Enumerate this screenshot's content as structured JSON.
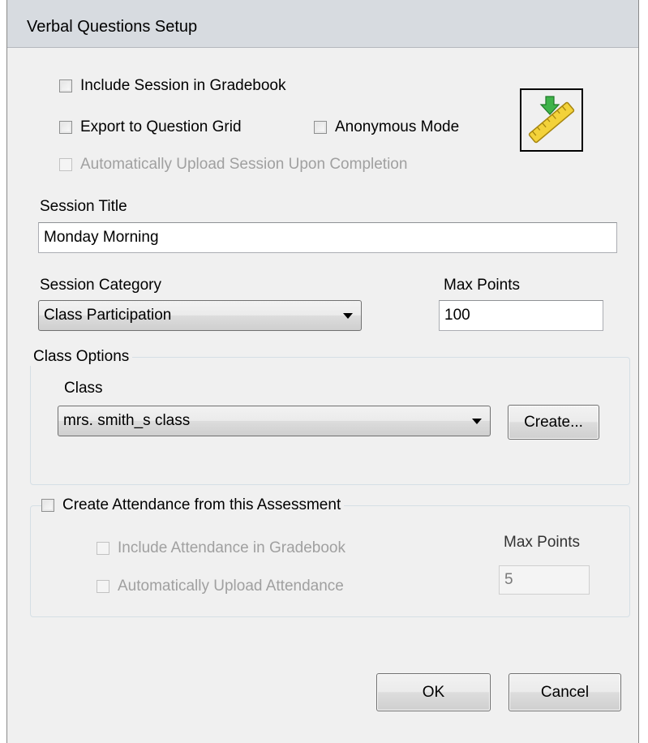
{
  "window": {
    "title": "Verbal Questions Setup"
  },
  "options": {
    "include_gradebook": {
      "label": "Include Session in Gradebook",
      "checked": false,
      "enabled": true
    },
    "export_grid": {
      "label": "Export to Question Grid",
      "checked": false,
      "enabled": true
    },
    "anonymous_mode": {
      "label": "Anonymous Mode",
      "checked": false,
      "enabled": true
    },
    "auto_upload": {
      "label": "Automatically Upload Session Upon Completion",
      "checked": false,
      "enabled": false
    }
  },
  "icon": {
    "name": "ruler-download-icon"
  },
  "session_title": {
    "label": "Session Title",
    "value": "Monday Morning"
  },
  "session_category": {
    "label": "Session Category",
    "selected": "Class Participation"
  },
  "max_points": {
    "label": "Max Points",
    "value": "100"
  },
  "class_options": {
    "group_title": "Class Options",
    "class_label": "Class",
    "class_selected": "mrs. smith_s class",
    "create_label": "Create..."
  },
  "attendance": {
    "create_label": "Create Attendance from this Assessment",
    "include_gradebook_label": "Include Attendance in Gradebook",
    "auto_upload_label": "Automatically Upload Attendance",
    "max_points_label": "Max Points",
    "max_points_value": "5"
  },
  "buttons": {
    "ok": "OK",
    "cancel": "Cancel"
  },
  "colors": {
    "titlebar": "#d7dbe0",
    "dialog_bg": "#f0f0f0",
    "disabled_text": "#a0a0a0"
  }
}
